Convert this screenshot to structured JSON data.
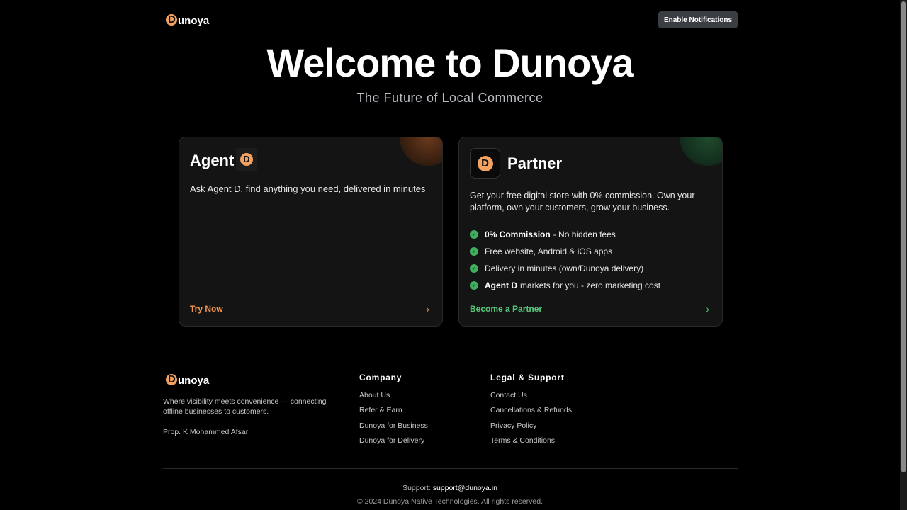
{
  "header": {
    "logo_letter": "D",
    "logo_text": "unoya",
    "notify_button": "Enable Notifications"
  },
  "hero": {
    "title": "Welcome to Dunoya",
    "subtitle": "The Future of Local Commerce"
  },
  "agent_card": {
    "title": "Agent",
    "badge_letter": "D",
    "description": "Ask Agent D, find anything you need, delivered in minutes",
    "cta": "Try Now",
    "cta_icon": "chevron-right-icon",
    "accent": "#f3944f"
  },
  "partner_card": {
    "badge_letter": "D",
    "title": "Partner",
    "description": "Get your free digital store with 0% commission. Own your platform, own your customers, grow your business.",
    "features": [
      {
        "bold": "0% Commission",
        "text": "- No hidden fees"
      },
      {
        "bold": "",
        "text": "Free website, Android & iOS apps"
      },
      {
        "bold": "",
        "text": "Delivery in minutes (own/Dunoya delivery)"
      },
      {
        "bold": "Agent D",
        "text": "markets for you - zero marketing cost"
      }
    ],
    "check_icon": "check-circle-icon",
    "cta": "Become a Partner",
    "cta_icon": "chevron-right-icon",
    "accent": "#55c77a"
  },
  "footer": {
    "logo_letter": "D",
    "logo_text": "unoya",
    "about": "Where visibility meets convenience — connecting offline businesses to customers.",
    "prop": "Prop. K Mohammed Afsar",
    "company": {
      "heading": "Company",
      "links": [
        "About Us",
        "Refer & Earn",
        "Dunoya for Business",
        "Dunoya for Delivery"
      ]
    },
    "legal": {
      "heading": "Legal & Support",
      "links": [
        "Contact Us",
        "Cancellations & Refunds",
        "Privacy Policy",
        "Terms & Conditions"
      ]
    },
    "support_label": "Support:",
    "support_email": "support@dunoya.in",
    "copyright": "© 2024 Dunoya Native Technologies. All rights reserved."
  }
}
